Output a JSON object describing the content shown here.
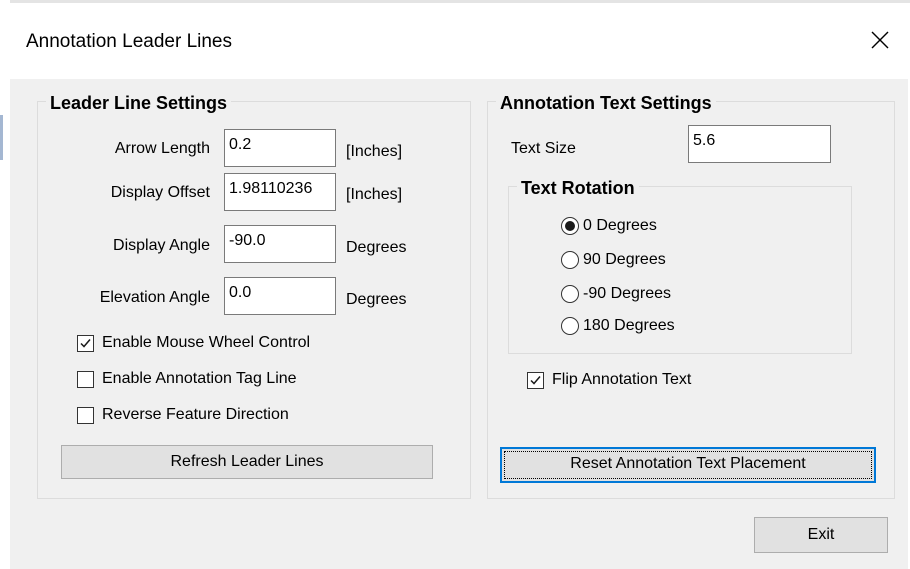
{
  "window": {
    "title": "Annotation Leader Lines"
  },
  "leader_line_settings": {
    "heading": "Leader Line Settings",
    "fields": [
      {
        "label": "Arrow Length",
        "value": "0.2",
        "unit": "[Inches]"
      },
      {
        "label": "Display Offset",
        "value": "1.98110236",
        "unit": "[Inches]"
      },
      {
        "label": "Display Angle",
        "value": "-90.0",
        "unit": "Degrees"
      },
      {
        "label": "Elevation Angle",
        "value": "0.0",
        "unit": "Degrees"
      }
    ],
    "checkboxes": [
      {
        "label": "Enable Mouse Wheel Control",
        "checked": true
      },
      {
        "label": "Enable Annotation Tag Line",
        "checked": false
      },
      {
        "label": "Reverse Feature Direction",
        "checked": false
      }
    ],
    "refresh_button": "Refresh Leader Lines"
  },
  "annotation_text_settings": {
    "heading": "Annotation Text Settings",
    "text_size_label": "Text Size",
    "text_size_value": "5.6",
    "rotation": {
      "heading": "Text Rotation",
      "options": [
        "0 Degrees",
        "90 Degrees",
        "-90 Degrees",
        "180 Degrees"
      ],
      "selected": "0 Degrees"
    },
    "flip_label": "Flip Annotation Text",
    "flip_checked": true,
    "reset_button": "Reset Annotation Text Placement"
  },
  "exit_button": "Exit",
  "icons": {
    "close": "close-icon",
    "check": "checkmark-icon"
  },
  "colors": {
    "focus_border": "#0078d7",
    "button_face": "#e1e1e1",
    "dialog_bg": "#f0f0f0"
  }
}
